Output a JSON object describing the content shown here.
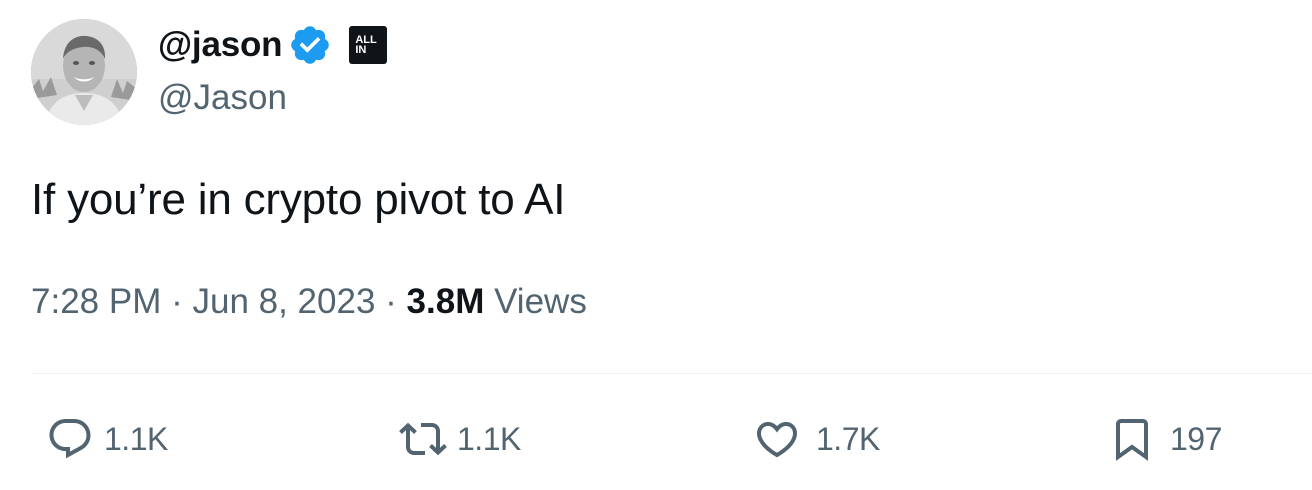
{
  "tweet": {
    "author": {
      "display_name": "@jason",
      "handle": "@Jason",
      "verified": true,
      "affiliate_badge": "ALL IN"
    },
    "text": "If you’re in crypto pivot to AI",
    "meta": {
      "time": "7:28 PM",
      "separator": "·",
      "date": "Jun 8, 2023",
      "views_count": "3.8M",
      "views_label": "Views"
    },
    "actions": {
      "replies": "1.1K",
      "reposts": "1.1K",
      "likes": "1.7K",
      "bookmarks": "197"
    }
  },
  "colors": {
    "primary_text": "#0f1419",
    "secondary_text": "#536471",
    "verified_blue": "#1d9bf0",
    "divider": "#eff3f4"
  },
  "icons": {
    "reply": "reply-icon",
    "repost": "repost-icon",
    "like": "heart-icon",
    "bookmark": "bookmark-icon",
    "verified": "verified-badge-icon"
  }
}
